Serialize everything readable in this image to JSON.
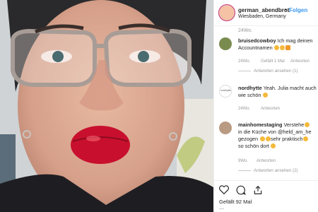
{
  "post": {
    "username": "german_abendbrot",
    "separator": "•",
    "follow_label": "Folgen",
    "location": "Wiesbaden, Germany",
    "top_time": "24Wo.",
    "likes": "Gefällt 92 Mal",
    "bottom_time": "—"
  },
  "comments": [
    {
      "user": "bruisedcowboy",
      "text_line1": "Ich mag deinen",
      "text_line2": "Accountnamen",
      "time": "24Wo.",
      "likes": "Gefällt 1 Mal",
      "reply": "Antworten",
      "view_replies": "Antworten ansehen (1)"
    },
    {
      "user": "nordhytte",
      "text_line1": "Yeah. Julia macht auch",
      "text_line2": "wie schön",
      "time": "24Wo.",
      "reply": "Antworten"
    },
    {
      "user": "mainhomestaging",
      "text_line1": "Verstehe",
      "text_line2": "in die Küche von @held_am_he",
      "text_line3": "gezogen",
      "text_line3b": "sehr praktisch",
      "text_line4": "so schön dort",
      "time": "9Wo.",
      "reply": "Antworten",
      "view_replies": "Antworten ansehen (2)"
    }
  ],
  "colors": {
    "link": "#3897f0",
    "lips": "#c8102e",
    "text": "#262626",
    "muted": "#999999"
  },
  "icons": [
    "heart-icon",
    "comment-icon",
    "share-icon"
  ]
}
